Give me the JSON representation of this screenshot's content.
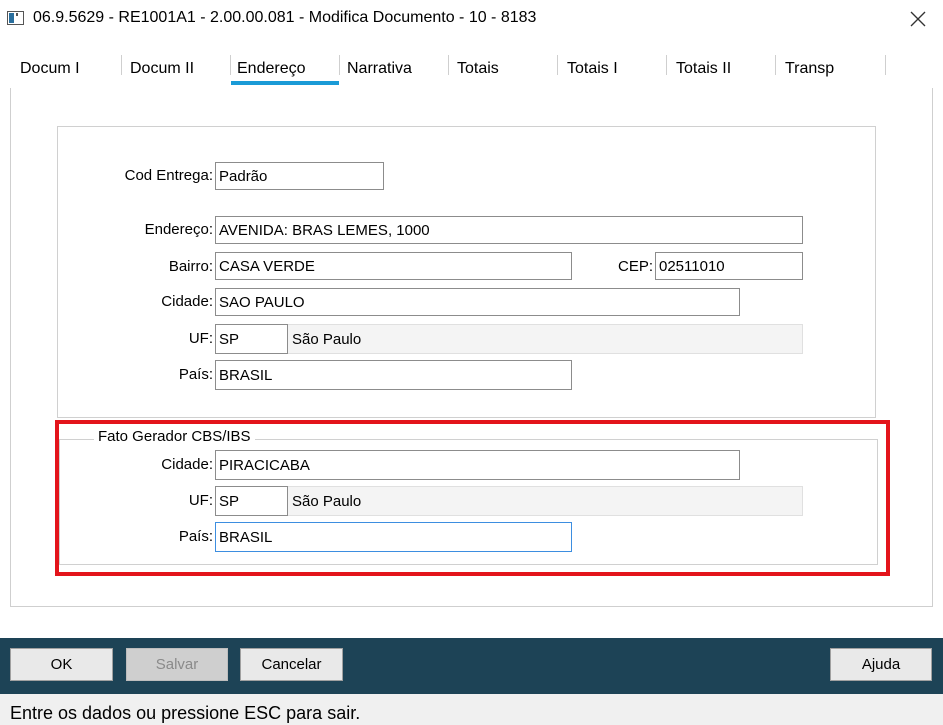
{
  "window": {
    "title": "06.9.5629 - RE1001A1 - 2.00.00.081 - Modifica Documento - 10 - 8183",
    "app_icon": "window-app-icon",
    "close_icon": "close-icon"
  },
  "tabs": [
    {
      "label": "Docum I"
    },
    {
      "label": "Docum II"
    },
    {
      "label": "Endereço",
      "active": true
    },
    {
      "label": "Narrativa"
    },
    {
      "label": "Totais"
    },
    {
      "label": "Totais I"
    },
    {
      "label": "Totais II"
    },
    {
      "label": "Transp"
    }
  ],
  "colors": {
    "active_tab_underline": "#1a9bd7",
    "highlight_border": "#e3141b",
    "button_bar": "#1d4356"
  },
  "address": {
    "cod_entrega": {
      "label": "Cod Entrega:",
      "value": "Padrão"
    },
    "endereco": {
      "label": "Endereço:",
      "value": "AVENIDA: BRAS LEMES, 1000"
    },
    "bairro": {
      "label": "Bairro:",
      "value": "CASA VERDE"
    },
    "cep": {
      "label": "CEP:",
      "value": "02511010"
    },
    "cidade": {
      "label": "Cidade:",
      "value": "SAO PAULO"
    },
    "uf": {
      "label": "UF:",
      "value": "SP",
      "description": "São Paulo"
    },
    "pais": {
      "label": "País:",
      "value": "BRASIL"
    }
  },
  "fato_gerador": {
    "title": "Fato Gerador CBS/IBS",
    "cidade": {
      "label": "Cidade:",
      "value": "PIRACICABA"
    },
    "uf": {
      "label": "UF:",
      "value": "SP",
      "description": "São Paulo"
    },
    "pais": {
      "label": "País:",
      "value": "BRASIL"
    }
  },
  "buttons": {
    "ok": "OK",
    "salvar": "Salvar",
    "cancelar": "Cancelar",
    "ajuda": "Ajuda"
  },
  "status": {
    "message": "Entre os dados ou pressione ESC para sair."
  }
}
